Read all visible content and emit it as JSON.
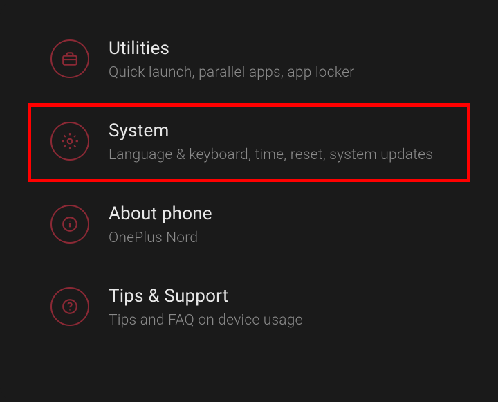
{
  "settings": {
    "items": [
      {
        "title": "Utilities",
        "subtitle": "Quick launch, parallel apps, app locker"
      },
      {
        "title": "System",
        "subtitle": "Language & keyboard, time, reset, system updates"
      },
      {
        "title": "About phone",
        "subtitle": "OnePlus Nord"
      },
      {
        "title": "Tips & Support",
        "subtitle": "Tips and FAQ on device usage"
      }
    ]
  },
  "highlight_color": "#ff0000",
  "accent_color": "#8B2935"
}
